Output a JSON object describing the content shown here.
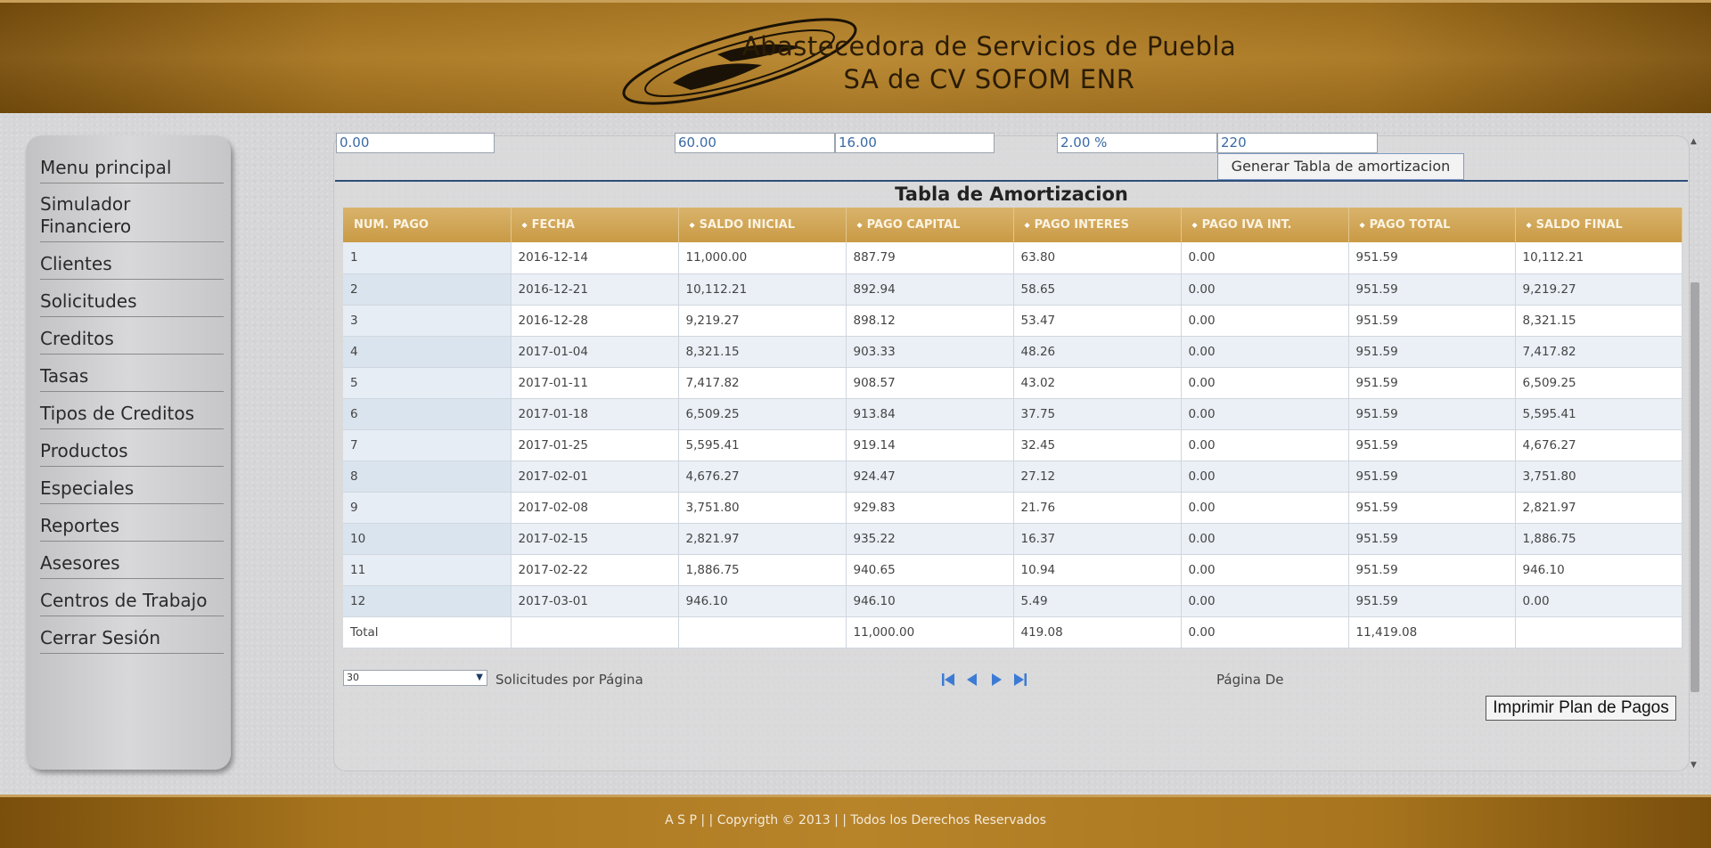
{
  "header": {
    "company_line1": "Abastecedora de Servicios de Puebla",
    "company_line2": "SA de CV SOFOM ENR"
  },
  "sidebar": {
    "items": [
      {
        "label": "Menu principal"
      },
      {
        "label": "Simulador Financiero"
      },
      {
        "label": "Clientes"
      },
      {
        "label": "Solicitudes"
      },
      {
        "label": "Creditos"
      },
      {
        "label": "Tasas"
      },
      {
        "label": "Tipos de Creditos"
      },
      {
        "label": "Productos"
      },
      {
        "label": "Especiales"
      },
      {
        "label": "Reportes"
      },
      {
        "label": "Asesores"
      },
      {
        "label": "Centros de Trabajo"
      },
      {
        "label": "Cerrar Sesión"
      }
    ]
  },
  "form": {
    "field1": "0.00",
    "field2": "60.00",
    "field3": "16.00",
    "field4": "2.00 %",
    "field5": "220",
    "generate_button": "Generar Tabla de amortizacion"
  },
  "table": {
    "title": "Tabla de Amortizacion",
    "headers": [
      "NUM. PAGO",
      "FECHA",
      "SALDO INICIAL",
      "PAGO CAPITAL",
      "PAGO INTERES",
      "PAGO IVA INT.",
      "PAGO TOTAL",
      "SALDO FINAL"
    ],
    "rows": [
      [
        "1",
        "2016-12-14",
        "11,000.00",
        "887.79",
        "63.80",
        "0.00",
        "951.59",
        "10,112.21"
      ],
      [
        "2",
        "2016-12-21",
        "10,112.21",
        "892.94",
        "58.65",
        "0.00",
        "951.59",
        "9,219.27"
      ],
      [
        "3",
        "2016-12-28",
        "9,219.27",
        "898.12",
        "53.47",
        "0.00",
        "951.59",
        "8,321.15"
      ],
      [
        "4",
        "2017-01-04",
        "8,321.15",
        "903.33",
        "48.26",
        "0.00",
        "951.59",
        "7,417.82"
      ],
      [
        "5",
        "2017-01-11",
        "7,417.82",
        "908.57",
        "43.02",
        "0.00",
        "951.59",
        "6,509.25"
      ],
      [
        "6",
        "2017-01-18",
        "6,509.25",
        "913.84",
        "37.75",
        "0.00",
        "951.59",
        "5,595.41"
      ],
      [
        "7",
        "2017-01-25",
        "5,595.41",
        "919.14",
        "32.45",
        "0.00",
        "951.59",
        "4,676.27"
      ],
      [
        "8",
        "2017-02-01",
        "4,676.27",
        "924.47",
        "27.12",
        "0.00",
        "951.59",
        "3,751.80"
      ],
      [
        "9",
        "2017-02-08",
        "3,751.80",
        "929.83",
        "21.76",
        "0.00",
        "951.59",
        "2,821.97"
      ],
      [
        "10",
        "2017-02-15",
        "2,821.97",
        "935.22",
        "16.37",
        "0.00",
        "951.59",
        "1,886.75"
      ],
      [
        "11",
        "2017-02-22",
        "1,886.75",
        "940.65",
        "10.94",
        "0.00",
        "951.59",
        "946.10"
      ],
      [
        "12",
        "2017-03-01",
        "946.10",
        "946.10",
        "5.49",
        "0.00",
        "951.59",
        "0.00"
      ]
    ],
    "total": [
      "Total",
      "",
      "",
      "11,000.00",
      "419.08",
      "0.00",
      "11,419.08",
      ""
    ]
  },
  "pager": {
    "page_size": "30",
    "page_size_label": "Solicitudes por Página",
    "page_info": "Página De",
    "icons": [
      "first-page-icon",
      "prev-page-icon",
      "next-page-icon",
      "last-page-icon"
    ]
  },
  "print_button": "Imprimir Plan de Pagos",
  "footer": {
    "text": "A S P  | |  Copyrigth © 2013  | |  Todos los Derechos Reservados"
  },
  "colors": {
    "header_brown": "#a8751e",
    "table_header_gold": "#c99a45",
    "nav_icon_blue": "#3c7bd4"
  }
}
